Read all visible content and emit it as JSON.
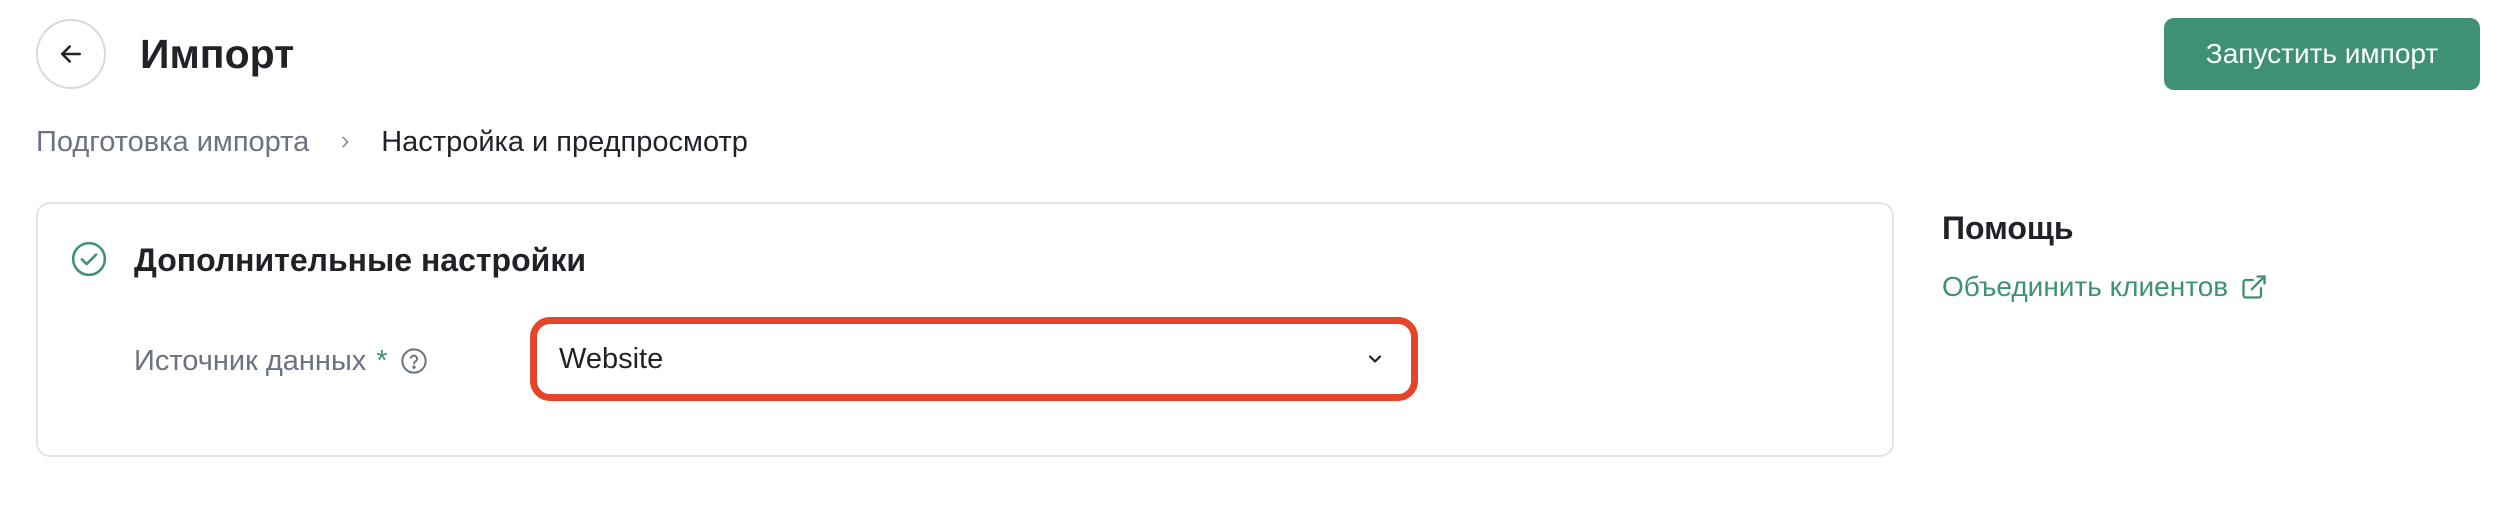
{
  "header": {
    "back_icon": "arrow-left-icon",
    "title": "Импорт",
    "run_button_label": "Запустить импорт",
    "accent_color": "#3f9173"
  },
  "breadcrumb": {
    "items": [
      "Подготовка импорта",
      "Настройка и предпросмотр"
    ],
    "separator": "›"
  },
  "settings_card": {
    "status_icon": "check-circle-icon",
    "title": "Дополнительные настройки",
    "field": {
      "label": "Источник данных",
      "required_mark": "*",
      "help_icon": "question-circle-icon",
      "selected_value": "Website",
      "chevron_icon": "chevron-down-icon",
      "highlight_color": "#e5432a"
    }
  },
  "help_panel": {
    "title": "Помощь",
    "link_label": "Объединить клиентов",
    "link_icon": "external-link-icon"
  }
}
